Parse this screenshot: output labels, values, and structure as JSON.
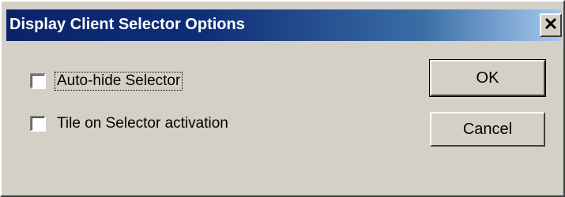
{
  "dialog": {
    "title": "Display Client Selector Options",
    "close_glyph": "✕"
  },
  "options": [
    {
      "label": "Auto-hide Selector",
      "checked": false,
      "focused": true
    },
    {
      "label": "Tile on Selector activation",
      "checked": false,
      "focused": false
    }
  ],
  "buttons": {
    "ok_label": "OK",
    "cancel_label": "Cancel"
  },
  "colors": {
    "title_bar_start": "#0a246a",
    "title_bar_end": "#a6caf0",
    "dialog_face": "#d4d0c8"
  }
}
